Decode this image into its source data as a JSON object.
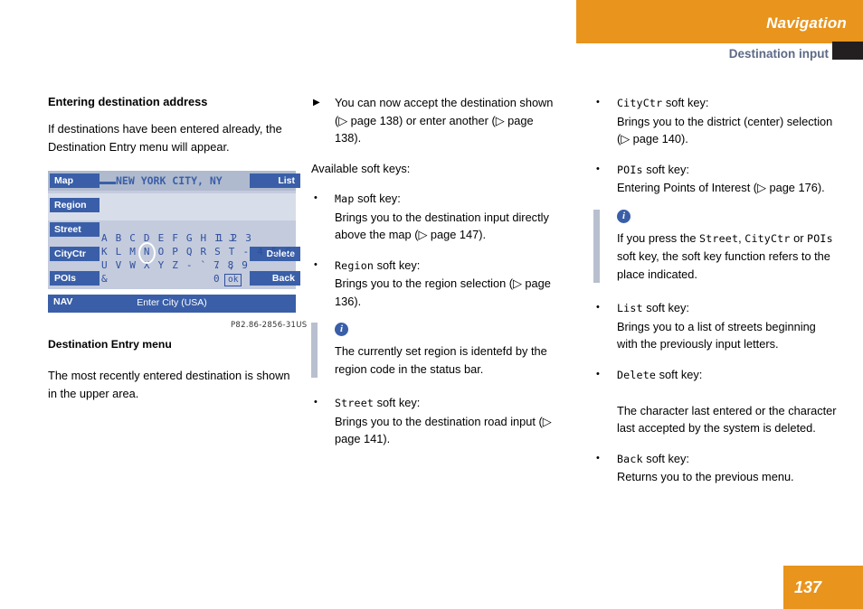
{
  "header": {
    "section": "Navigation",
    "subsection": "Destination input"
  },
  "page_number": "137",
  "col1": {
    "heading": "Entering destination address",
    "intro": "If destinations have been entered already, the Destination Entry menu will appear.",
    "figure": {
      "soft_keys_left": [
        "Map",
        "Region",
        "Street",
        "CityCtr",
        "POIs"
      ],
      "soft_keys_right": [
        "List",
        "Delete",
        "Back"
      ],
      "city_value": "NEW YORK CITY, NY",
      "char_rows": [
        "A B C D E F G H I J",
        "K L M N O P Q R S T - 4 5 6",
        "U V W X Y Z - ` . ,",
        "&"
      ],
      "numbers_row1": "1 2 3",
      "numbers_row3": "7 8 9",
      "numbers_row4": "0",
      "ok_label": "ok",
      "status_left": "NAV",
      "status_center": "Enter City (USA)",
      "figure_code": "P82.86-2856-31US"
    },
    "caption": "Destination Entry menu",
    "after_caption": "The most recently entered destination is shown in the upper area."
  },
  "col2": {
    "accept_item": "You can now accept the destination shown (▷ page 138) or enter another (▷ page 138).",
    "available_label": "Available soft keys:",
    "items": [
      {
        "key": "Map",
        "key_suffix": " soft key:",
        "text": "Brings you to the destination input directly above the map (▷ page 147)."
      },
      {
        "key": "Region",
        "key_suffix": " soft key:",
        "text": "Brings you to the region selection (▷ page 136)."
      },
      {
        "key": "Street",
        "key_suffix": " soft key:",
        "text": "Brings you to the destination road input (▷ page 141)."
      }
    ],
    "note": "The currently set region is identefd by the region code in the status bar."
  },
  "col3": {
    "items_top": [
      {
        "key": "CityCtr",
        "key_suffix": " soft key:",
        "text": "Brings you to the district (center) selection (▷ page 140)."
      },
      {
        "key": "POIs",
        "key_suffix": " soft key:",
        "text": "Entering Points of Interest (▷ page 176)."
      }
    ],
    "note_parts": {
      "p1": "If you press the ",
      "k1": "Street",
      "p2": ", ",
      "k2": "CityCtr",
      "p3": " or ",
      "k3": "POIs",
      "p4": " soft key, the soft key function refers to the place indicated."
    },
    "items_bottom": [
      {
        "key": "List",
        "key_suffix": " soft key:",
        "text": "Brings you to a list of streets beginning with the previously input letters."
      },
      {
        "key": "Delete",
        "key_suffix": " soft key:",
        "text": "The character last entered or the character last accepted by the system is deleted."
      },
      {
        "key": "Back",
        "key_suffix": " soft key:",
        "text": "Returns you to the previous menu."
      }
    ]
  },
  "icons": {
    "info": "i",
    "triangle_marker": "▶",
    "bullet_marker": "•",
    "city_icon": "▬▬"
  }
}
